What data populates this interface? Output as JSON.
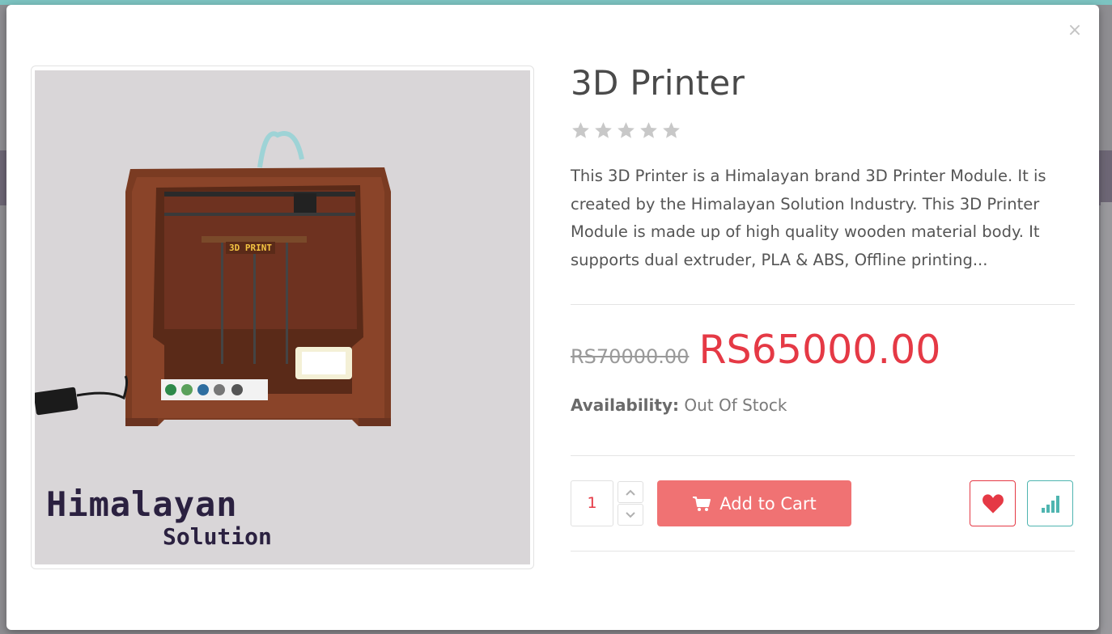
{
  "modal": {
    "close_label": "×"
  },
  "product": {
    "title": "3D Printer",
    "rating_stars": 0,
    "rating_max": 5,
    "description": "This 3D Printer is a Himalayan brand 3D Printer Module. It is created by the Himalayan Solution Industry. This 3D Printer Module is made up of high quality wooden material body. It supports dual extruder, PLA & ABS, Offline printing...",
    "old_price": "RS70000.00",
    "price": "RS65000.00",
    "availability_label": "Availability:",
    "availability_value": "Out Of Stock",
    "quantity": "1",
    "image": {
      "front_label": "3D PRINT",
      "logo_line1": "Himalayan",
      "logo_line2": "Solution"
    }
  },
  "actions": {
    "add_to_cart_label": "Add to Cart",
    "wishlist_icon": "heart-icon",
    "compare_icon": "bar-chart-icon"
  },
  "colors": {
    "accent_red": "#e53945",
    "cart_button": "#f07273",
    "teal": "#4fb5b0",
    "star_gray": "#c8c8c8"
  }
}
